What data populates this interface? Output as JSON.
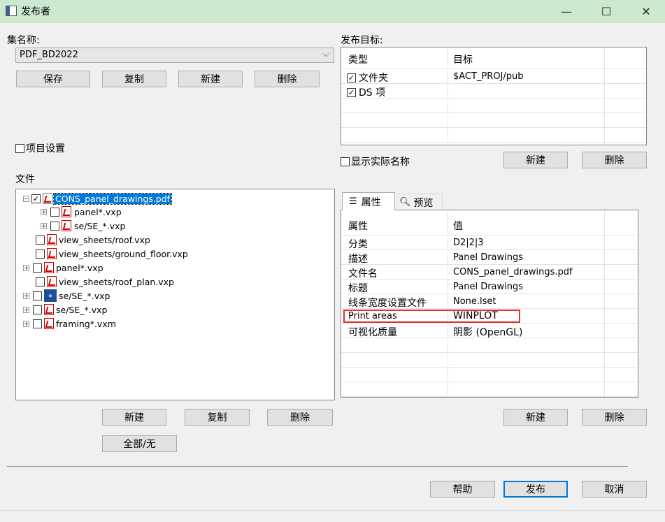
{
  "window": {
    "title": "发布者",
    "minimize": "—",
    "maximize": "☐",
    "close": "✕"
  },
  "set": {
    "label": "集名称:",
    "selected": "PDF_BD2022",
    "buttons": {
      "save": "保存",
      "copy": "复制",
      "new": "新建",
      "delete": "删除"
    },
    "project_settings": "项目设置"
  },
  "files": {
    "label": "文件",
    "tree": [
      {
        "text": "CONS_panel_drawings.pdf",
        "checked": true,
        "selected": true
      },
      {
        "text": "panel*.vxp"
      },
      {
        "text": "se/SE_*.vxp"
      },
      {
        "text": "view_sheets/roof.vxp"
      },
      {
        "text": "view_sheets/ground_floor.vxp"
      },
      {
        "text": "panel*.vxp"
      },
      {
        "text": "view_sheets/roof_plan.vxp"
      },
      {
        "text": "se/SE_*.vxp"
      },
      {
        "text": "se/SE_*.vxp"
      },
      {
        "text": "framing*.vxm"
      }
    ],
    "buttons": {
      "new": "新建",
      "copy": "复制",
      "delete": "删除",
      "all_none": "全部/无"
    }
  },
  "targets": {
    "label": "发布目标:",
    "headers": {
      "type": "类型",
      "target": "目标"
    },
    "rows": [
      {
        "type": "文件夹",
        "target": "$ACT_PROJ/pub",
        "checked": true
      },
      {
        "type": "DS 项",
        "target": "",
        "checked": true
      }
    ],
    "show_actual_names": "显示实际名称",
    "buttons": {
      "new": "新建",
      "delete": "删除"
    }
  },
  "tabs": {
    "properties": "属性",
    "preview": "预览"
  },
  "properties": {
    "headers": {
      "property": "属性",
      "value": "值"
    },
    "rows": [
      {
        "name": "分类",
        "value": "D2|2|3"
      },
      {
        "name": "描述",
        "value": "Panel Drawings"
      },
      {
        "name": "文件名",
        "value": "CONS_panel_drawings.pdf"
      },
      {
        "name": "标题",
        "value": "Panel Drawings"
      },
      {
        "name": "线条宽度设置文件",
        "value": "None.lset"
      },
      {
        "name": "Print areas",
        "value": "WINPLOT",
        "highlighted": true
      },
      {
        "name": "可视化质量",
        "value": "阴影 (OpenGL)"
      }
    ],
    "buttons": {
      "new": "新建",
      "delete": "删除"
    }
  },
  "footer": {
    "help": "帮助",
    "publish": "发布",
    "cancel": "取消"
  },
  "colors": {
    "titlebar": "#cce8cf",
    "selection": "#0078d7",
    "highlight_border": "#e03030"
  }
}
